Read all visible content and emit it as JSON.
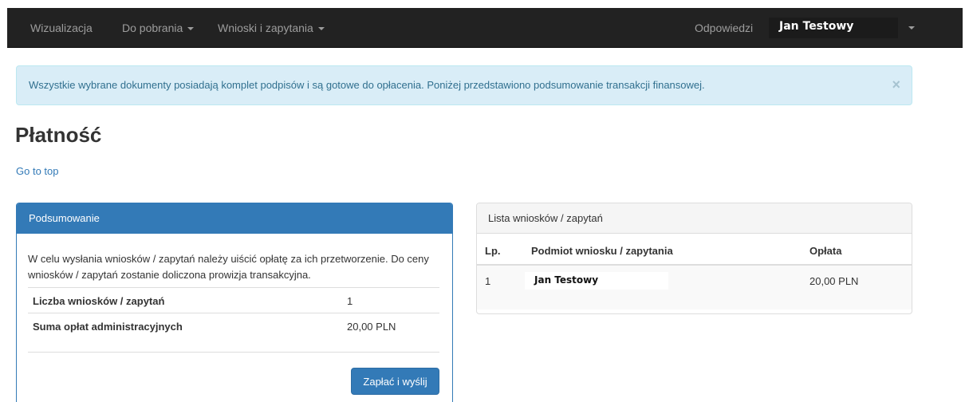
{
  "navbar": {
    "items": [
      {
        "label": "Wizualizacja"
      },
      {
        "label": "Do pobrania"
      },
      {
        "label": "Wnioski i zapytania"
      }
    ],
    "right_link": "Odpowiedzi",
    "user_name": "Jan Testowy"
  },
  "alert": {
    "text": "Wszystkie wybrane dokumenty posiadają komplet podpisów i są gotowe do opłacenia. Poniżej przedstawiono podsumowanie transakcji finansowej.",
    "close": "×"
  },
  "page": {
    "title": "Płatność",
    "go_top": "Go to top"
  },
  "summary": {
    "heading": "Podsumowanie",
    "intro": "W celu wysłania wniosków / zapytań należy uiścić opłatę za ich przetworzenie. Do ceny wniosków / zapytań zostanie doliczona prowizja transakcyjna.",
    "rows": [
      {
        "label": "Liczba wniosków / zapytań",
        "value": "1"
      },
      {
        "label": "Suma opłat administracyjnych",
        "value": "20,00 PLN"
      }
    ],
    "pay_button": "Zapłać i wyślij"
  },
  "list": {
    "heading": "Lista wniosków / zapytań",
    "columns": [
      "Lp.",
      "Podmiot wniosku / zapytania",
      "Opłata"
    ],
    "rows": [
      {
        "lp": "1",
        "subject": "Jan Testowy",
        "fee": "20,00 PLN"
      }
    ]
  },
  "colors": {
    "navbar_bg": "#222222",
    "primary": "#337ab7",
    "alert_bg": "#d9edf7",
    "alert_text": "#31708f"
  }
}
